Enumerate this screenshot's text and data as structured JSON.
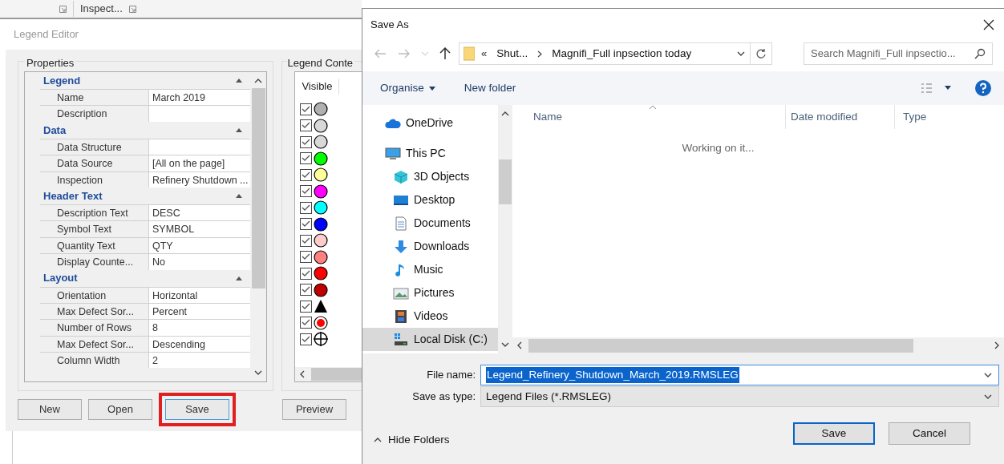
{
  "app_tab": {
    "label": "Inspect..."
  },
  "editor": {
    "title": "Legend Editor",
    "properties": {
      "title": "Properties",
      "categories": [
        {
          "name": "Legend",
          "expanded": true,
          "rows": [
            {
              "name": "Name",
              "value": "March 2019"
            },
            {
              "name": "Description",
              "value": ""
            }
          ]
        },
        {
          "name": "Data",
          "expanded": true,
          "rows": [
            {
              "name": "Data Structure",
              "value": ""
            },
            {
              "name": "Data Source",
              "value": "[All on the page]"
            },
            {
              "name": "Inspection",
              "value": "Refinery Shutdown ..."
            }
          ]
        },
        {
          "name": "Header Text",
          "expanded": true,
          "rows": [
            {
              "name": "Description Text",
              "value": "DESC"
            },
            {
              "name": "Symbol Text",
              "value": "SYMBOL"
            },
            {
              "name": "Quantity Text",
              "value": "QTY"
            },
            {
              "name": "Display Counte...",
              "value": "No"
            }
          ]
        },
        {
          "name": "Layout",
          "expanded": true,
          "rows": [
            {
              "name": "Orientation",
              "value": "Horizontal"
            },
            {
              "name": "Max Defect Sor...",
              "value": "Percent"
            },
            {
              "name": "Number of Rows",
              "value": "8"
            },
            {
              "name": "Max Defect Sor...",
              "value": "Descending"
            },
            {
              "name": "Column Width",
              "value": "2"
            }
          ]
        }
      ]
    },
    "legend_content": {
      "title": "Legend Conte",
      "column": "Visible",
      "items": [
        {
          "checked": true,
          "kind": "circle",
          "color": "#b0b0b0"
        },
        {
          "checked": true,
          "kind": "circle",
          "color": "#d8d8d8"
        },
        {
          "checked": true,
          "kind": "circle",
          "color": "#d8d8d8"
        },
        {
          "checked": true,
          "kind": "circle",
          "color": "#00ff00"
        },
        {
          "checked": true,
          "kind": "circle",
          "color": "#ffff99"
        },
        {
          "checked": true,
          "kind": "circle",
          "color": "#ff00ff"
        },
        {
          "checked": true,
          "kind": "circle",
          "color": "#00ffff"
        },
        {
          "checked": true,
          "kind": "circle",
          "color": "#0000ff"
        },
        {
          "checked": true,
          "kind": "circle",
          "color": "#ffcccc"
        },
        {
          "checked": true,
          "kind": "circle",
          "color": "#ff8080"
        },
        {
          "checked": true,
          "kind": "circle",
          "color": "#ff0000"
        },
        {
          "checked": true,
          "kind": "circle",
          "color": "#c00000"
        },
        {
          "checked": true,
          "kind": "triangle",
          "color": "#000000"
        },
        {
          "checked": true,
          "kind": "target",
          "color": "#ff0000"
        },
        {
          "checked": true,
          "kind": "crosshair"
        }
      ]
    },
    "buttons": [
      {
        "label": "New",
        "highlighted": false
      },
      {
        "label": "Open",
        "highlighted": false
      },
      {
        "label": "Save",
        "highlighted": true
      }
    ],
    "preview_button": "Preview"
  },
  "dialog": {
    "title": "Save As",
    "path": [
      {
        "label": "Shut..."
      },
      {
        "label": "Magnifi_Full inpsection today"
      }
    ],
    "path_prefix": "«",
    "search": {
      "placeholder": "Search Magnifi_Full inpsectio..."
    },
    "toolbar": {
      "organise": "Organise",
      "new_folder": "New folder"
    },
    "nav": [
      {
        "label": "OneDrive",
        "kind": "cloud",
        "selected": false
      },
      {
        "label": "This PC",
        "kind": "pc",
        "selected": false,
        "children": [
          {
            "label": "3D Objects",
            "kind": "cube",
            "selected": false
          },
          {
            "label": "Desktop",
            "kind": "desktop",
            "selected": false
          },
          {
            "label": "Documents",
            "kind": "document",
            "selected": false
          },
          {
            "label": "Downloads",
            "kind": "download",
            "selected": false
          },
          {
            "label": "Music",
            "kind": "music",
            "selected": false
          },
          {
            "label": "Pictures",
            "kind": "pictures",
            "selected": false
          },
          {
            "label": "Videos",
            "kind": "videos",
            "selected": false
          },
          {
            "label": "Local Disk (C:)",
            "kind": "disk",
            "selected": true
          }
        ]
      }
    ],
    "columns": [
      "Name",
      "Date modified",
      "Type"
    ],
    "status": "Working on it...",
    "file_name": {
      "label": "File name:",
      "value": "Legend_Refinery_Shutdown_March_2019.RMSLEG"
    },
    "save_type": {
      "label": "Save as type:",
      "value": "Legend Files (*.RMSLEG)"
    },
    "hide_folders": "Hide Folders",
    "buttons": [
      {
        "label": "Save",
        "default": true
      },
      {
        "label": "Cancel",
        "default": false
      }
    ]
  }
}
